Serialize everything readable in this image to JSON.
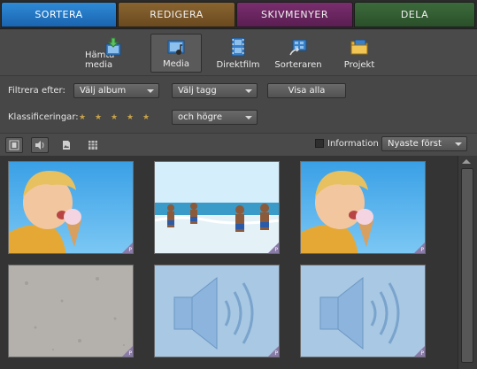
{
  "tabs": [
    {
      "label": "SORTERA",
      "color": "#2f8ad6"
    },
    {
      "label": "REDIGERA",
      "color": "#8a6430"
    },
    {
      "label": "SKIVMENYER",
      "color": "#7a2e6e"
    },
    {
      "label": "DELA",
      "color": "#3c6a3c"
    }
  ],
  "toolbar": {
    "items": [
      {
        "label": "Hämta media",
        "icon": "download-media-icon"
      },
      {
        "label": "Media",
        "icon": "media-icon",
        "selected": true
      },
      {
        "label": "Direktfilm",
        "icon": "filmstrip-icon"
      },
      {
        "label": "Sorteraren",
        "icon": "organizer-icon"
      },
      {
        "label": "Projekt",
        "icon": "project-folder-icon"
      }
    ]
  },
  "filter": {
    "label": "Filtrera efter:",
    "album_value": "Välj album",
    "tag_value": "Välj tagg",
    "show_all": "Visa alla"
  },
  "rating": {
    "label": "Klassificeringar:",
    "stars": 5,
    "condition_value": "och högre"
  },
  "viewbar": {
    "information_label": "Information",
    "information_checked": false,
    "sort_value": "Nyaste först"
  },
  "thumbnails": [
    {
      "type": "photo",
      "subject": "boy-ice-cream",
      "badge": "P"
    },
    {
      "type": "photo",
      "subject": "kids-beach",
      "badge": "P"
    },
    {
      "type": "photo",
      "subject": "boy-ice-cream",
      "badge": "P"
    },
    {
      "type": "photo",
      "subject": "gray-texture",
      "badge": "P"
    },
    {
      "type": "audio",
      "subject": "speaker",
      "badge": "P"
    },
    {
      "type": "audio",
      "subject": "speaker",
      "badge": "P"
    }
  ],
  "colors": {
    "background": "#474747",
    "grid": "#343434",
    "accent": "#2f8ad6",
    "star": "#c7a24a"
  }
}
